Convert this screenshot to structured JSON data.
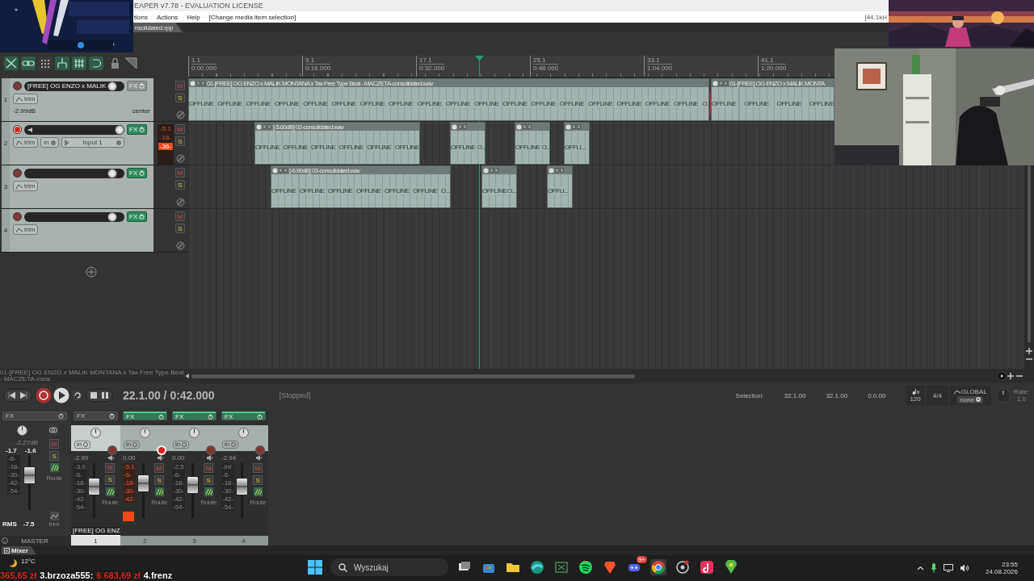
{
  "window": {
    "title": "EAPER v7.78 - EVALUATION LICENSE"
  },
  "menu": [
    {
      "label": "tions"
    },
    {
      "label": "Actions"
    },
    {
      "label": "Help"
    }
  ],
  "action_hint": "[Change media item selection]",
  "sample_rate": "[44.1kH",
  "project_tab": {
    "label": "nsolidated.rpp",
    "selected": true
  },
  "ruler": [
    {
      "bar": "1.1",
      "time": "0:00.000"
    },
    {
      "bar": "9.1",
      "time": "0:16.000"
    },
    {
      "bar": "17.1",
      "time": "0:32.000"
    },
    {
      "bar": "25.1",
      "time": "0:48.000"
    },
    {
      "bar": "33.1",
      "time": "1:04.000"
    },
    {
      "bar": "41.1",
      "time": "1:20.000"
    }
  ],
  "tracks": [
    {
      "number": "1",
      "name": "[FREE] OG ENZO x MALIK",
      "armed": false,
      "fx": "FX",
      "fx_active": false,
      "trim": "trim",
      "volume": "-2.99dB",
      "pan": "center",
      "mute": "M",
      "solo": "S",
      "level": 0.92
    },
    {
      "number": "2",
      "armed": true,
      "fx": "FX",
      "fx_active": true,
      "trim": "trim",
      "input_mode": "in",
      "input": "Input 1",
      "mute": "M",
      "solo": "S",
      "level": 1.0,
      "meter": [
        "-5.1",
        "-18-",
        "-36-"
      ]
    },
    {
      "number": "3",
      "armed": false,
      "fx": "FX",
      "fx_active": true,
      "trim": "trim",
      "mute": "M",
      "solo": "S",
      "level": 0.92
    },
    {
      "number": "4",
      "armed": false,
      "fx": "FX",
      "fx_active": true,
      "trim": "trim",
      "mute": "M",
      "solo": "S",
      "level": 0.92
    }
  ],
  "lanes": [
    {
      "items": [
        {
          "header": "01-[FREE] OG ENZO x MALIK MONTANA x Tax Free Type Beat - MACZETA-consolidated.wav",
          "labels": [
            "OFFLINE",
            "OFFLINE",
            "OFFLINE",
            "OFFLINE",
            "OFFLINE",
            "OFFLINE",
            "OFFLINE",
            "OFFLINE",
            "OFFLINE",
            "OFFLINE",
            "OFFLINE",
            "OFFLINE",
            "OFFLINE",
            "OFFLINE",
            "OFFLINE",
            "OFFLINE",
            "OFFLINE",
            "OFFLINE",
            "O."
          ]
        },
        {
          "header": "01-[FREE] OG ENZO x MALIK MONTA",
          "labels": [
            "OFFLINE",
            "OFFLINE",
            "OFFLINE",
            "OFFLINE"
          ]
        }
      ]
    },
    {
      "items": [
        {
          "header": "[-5.60dB] 02-consolidated.wav",
          "labels": [
            "OFFLINE",
            "OFFLINE",
            "OFFLINE",
            "OFFLINE",
            "OFFLINE",
            "OFFLINE"
          ]
        },
        {
          "labels": [
            "OFFLINE",
            "O.."
          ]
        },
        {
          "labels": [
            "OFFLINE",
            "O.."
          ]
        },
        {
          "labels": [
            "OFFLI..."
          ]
        }
      ]
    },
    {
      "items": [
        {
          "header": "[-6.90dB] 03-consolidated.wav",
          "labels": [
            "OFFLINE",
            "OFFLINE",
            "OFFLINE",
            "OFFLINE",
            "OFFLINE",
            "OFFLINE",
            "O..."
          ]
        },
        {
          "labels": [
            "OFFLINE",
            "O..."
          ]
        },
        {
          "labels": [
            "OFFLI..."
          ]
        }
      ]
    }
  ],
  "scroll_label": "01-[FREE] OG ENZO x MALIK MONTANA x Tax Free Type Beat - MACZETA-cons",
  "transport": {
    "position": "22.1.00 / 0:42.000",
    "status": "[Stopped]",
    "selection_label": "Selection:",
    "selection": [
      "32.1.00",
      "32.1.00",
      "0.0.00"
    ],
    "tempo": "120",
    "time_signature": "4/4",
    "envelope_mode": "GLOBAL",
    "automation": "none",
    "rate_label": "Rate:",
    "rate": "1.0"
  },
  "master": {
    "fx": "FX",
    "volume": "-2.27dB",
    "peaks": [
      "-1.7",
      "-1.6"
    ],
    "scale": [
      "-6-",
      "-18-",
      "-30-",
      "-42-",
      "-54-"
    ],
    "mute": "M",
    "solo": "S",
    "route": "Route",
    "trim": "trim",
    "rms_label": "RMS",
    "rms": "-7.5",
    "name": "MASTER",
    "level": 0.7
  },
  "strips": [
    {
      "number": "1",
      "name": "[FREE] OG ENZ",
      "selected": true,
      "armed": false,
      "fx": "FX",
      "fx_active": false,
      "input": "in",
      "volume": "-2.99",
      "peak": "-3.0",
      "scale": [
        "-6-",
        "-18-",
        "-30-",
        "-42-",
        "-54-"
      ],
      "clipping": false,
      "mute": "M",
      "solo": "S",
      "route": "Route",
      "level": 0.6
    },
    {
      "number": "2",
      "selected": false,
      "armed": true,
      "fx": "FX",
      "fx_active": true,
      "input": "in",
      "volume": "0.00",
      "peak": "-5.1",
      "scale": [
        "-6-",
        "-18-",
        "-30-",
        "-42-"
      ],
      "clipping": true,
      "mute": "M",
      "solo": "S",
      "route": "Route",
      "level": 0.7
    },
    {
      "number": "3",
      "selected": false,
      "armed": false,
      "fx": "FX",
      "fx_active": true,
      "input": "in",
      "volume": "0.00",
      "peak": "-2.5",
      "scale": [
        "-6-",
        "-18-",
        "-30-",
        "-42-",
        "-54-"
      ],
      "clipping": false,
      "mute": "M",
      "solo": "S",
      "route": "Route",
      "level": 0.65
    },
    {
      "number": "4",
      "selected": false,
      "armed": false,
      "fx": "FX",
      "fx_active": true,
      "input": "in",
      "volume": "-2.94",
      "peak": "-inf",
      "scale": [
        "-6-",
        "-18-",
        "-30-",
        "-42-",
        "-54-"
      ],
      "clipping": false,
      "mute": "M",
      "solo": "S",
      "route": "Route",
      "level": 0.6
    }
  ],
  "mixer_tab": {
    "label": "Mixer",
    "selected": true
  },
  "taskbar": {
    "weather": "12°C",
    "search_placeholder": "Wyszukaj",
    "badge": "9+",
    "time": "23:55",
    "date": "24.08.2026"
  },
  "ticker": [
    {
      "text": "365,65 zł",
      "kind": "amount"
    },
    {
      "text": "3.brzoza555:",
      "kind": "name"
    },
    {
      "text": "6 683,69 zł",
      "kind": "amount"
    },
    {
      "text": "4.frenz",
      "kind": "name"
    }
  ]
}
